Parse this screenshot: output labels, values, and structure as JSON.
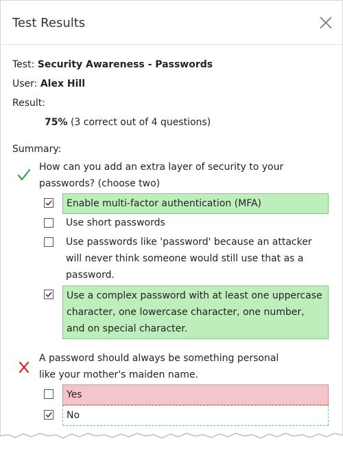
{
  "dialog": {
    "title": "Test Results",
    "close_icon": "close-icon"
  },
  "info": {
    "test_label": "Test:",
    "test_name": "Security Awareness - Passwords",
    "user_label": "User:",
    "user_name": "Alex Hill",
    "result_label": "Result:",
    "score": "75%",
    "score_detail": "(3 correct out of 4 questions)"
  },
  "summary": {
    "label": "Summary:",
    "questions": [
      {
        "status": "correct",
        "status_icon": "check-icon",
        "text": "How can you add an extra layer of security to your passwords? (choose two)",
        "answers": [
          {
            "text": "Enable multi-factor authentication (MFA)",
            "checked": true,
            "highlight": "correct"
          },
          {
            "text": "Use short passwords",
            "checked": false,
            "highlight": "none"
          },
          {
            "text": "Use passwords like 'password' because an attacker will never think someone would still use that as a password.",
            "checked": false,
            "highlight": "none"
          },
          {
            "text": "Use a complex password with at least one uppercase character, one lowercase character, one number, and on special character.",
            "checked": true,
            "highlight": "correct"
          }
        ]
      },
      {
        "status": "incorrect",
        "status_icon": "x-icon",
        "text": "A password should always be something personal like your mother's maiden name.",
        "answers": [
          {
            "text": "Yes",
            "checked": false,
            "highlight": "incorrect"
          },
          {
            "text": "No",
            "checked": true,
            "highlight": "focus"
          }
        ]
      }
    ]
  },
  "colors": {
    "correct_fill": "#bfeebd",
    "correct_border": "#86c983",
    "incorrect_fill": "#f5c6c9",
    "incorrect_border": "#e08a90",
    "check_mark": "#2eaa4a",
    "x_mark": "#d9262f"
  }
}
